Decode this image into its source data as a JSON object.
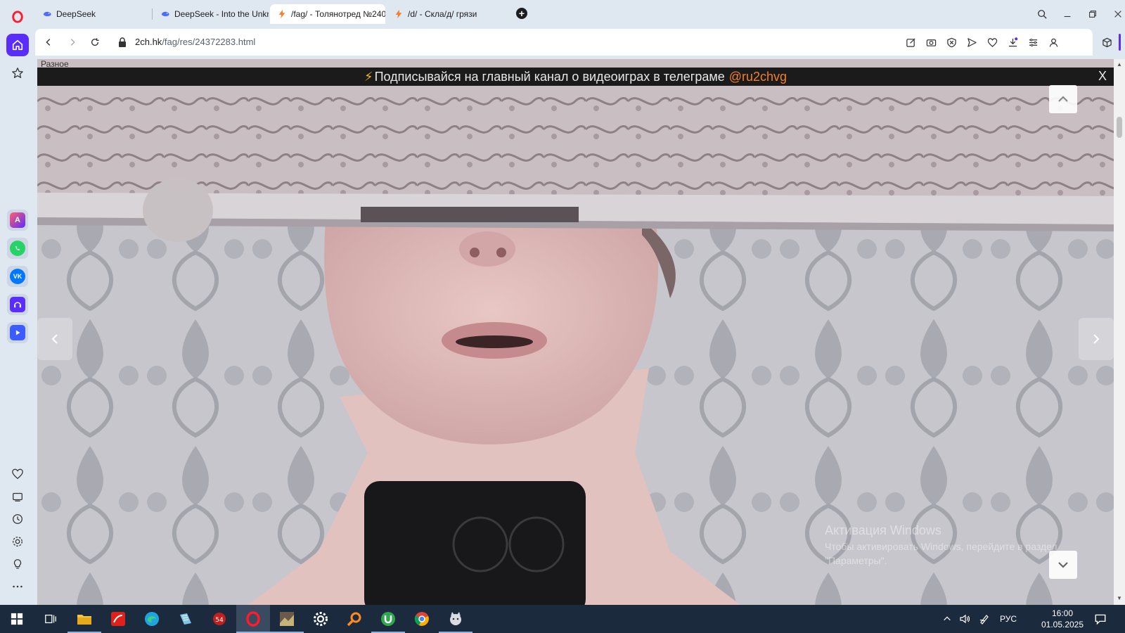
{
  "browser": {
    "tabs": [
      {
        "title": "DeepSeek",
        "active": false
      },
      {
        "title": "DeepSeek - Into the Unkn",
        "active": false
      },
      {
        "title": "/fag/ - Толянотред №240",
        "active": true
      },
      {
        "title": "/d/ - Скла/д/ грязи",
        "active": false
      }
    ],
    "new_tab_label": "+",
    "url_host": "2ch.hk",
    "url_path": "/fag/res/24372283.html"
  },
  "page": {
    "top_stub": "Разное",
    "banner": {
      "bolt": "⚡",
      "text": "Подписывайся на главный канал о видеоиграх в телеграме",
      "handle": "@ru2chvg",
      "close": "X"
    },
    "watermark": {
      "line1": "Активация Windows",
      "line2": "Чтобы активировать Windows, перейдите в раздел",
      "line3": "\"Параметры\"."
    }
  },
  "taskbar": {
    "language": "РУС",
    "time": "16:00",
    "date": "01.05.2025"
  },
  "colors": {
    "accent": "#5b2dfd",
    "banner_handle": "#f27f2b",
    "taskbar": "#1c2a3e"
  }
}
